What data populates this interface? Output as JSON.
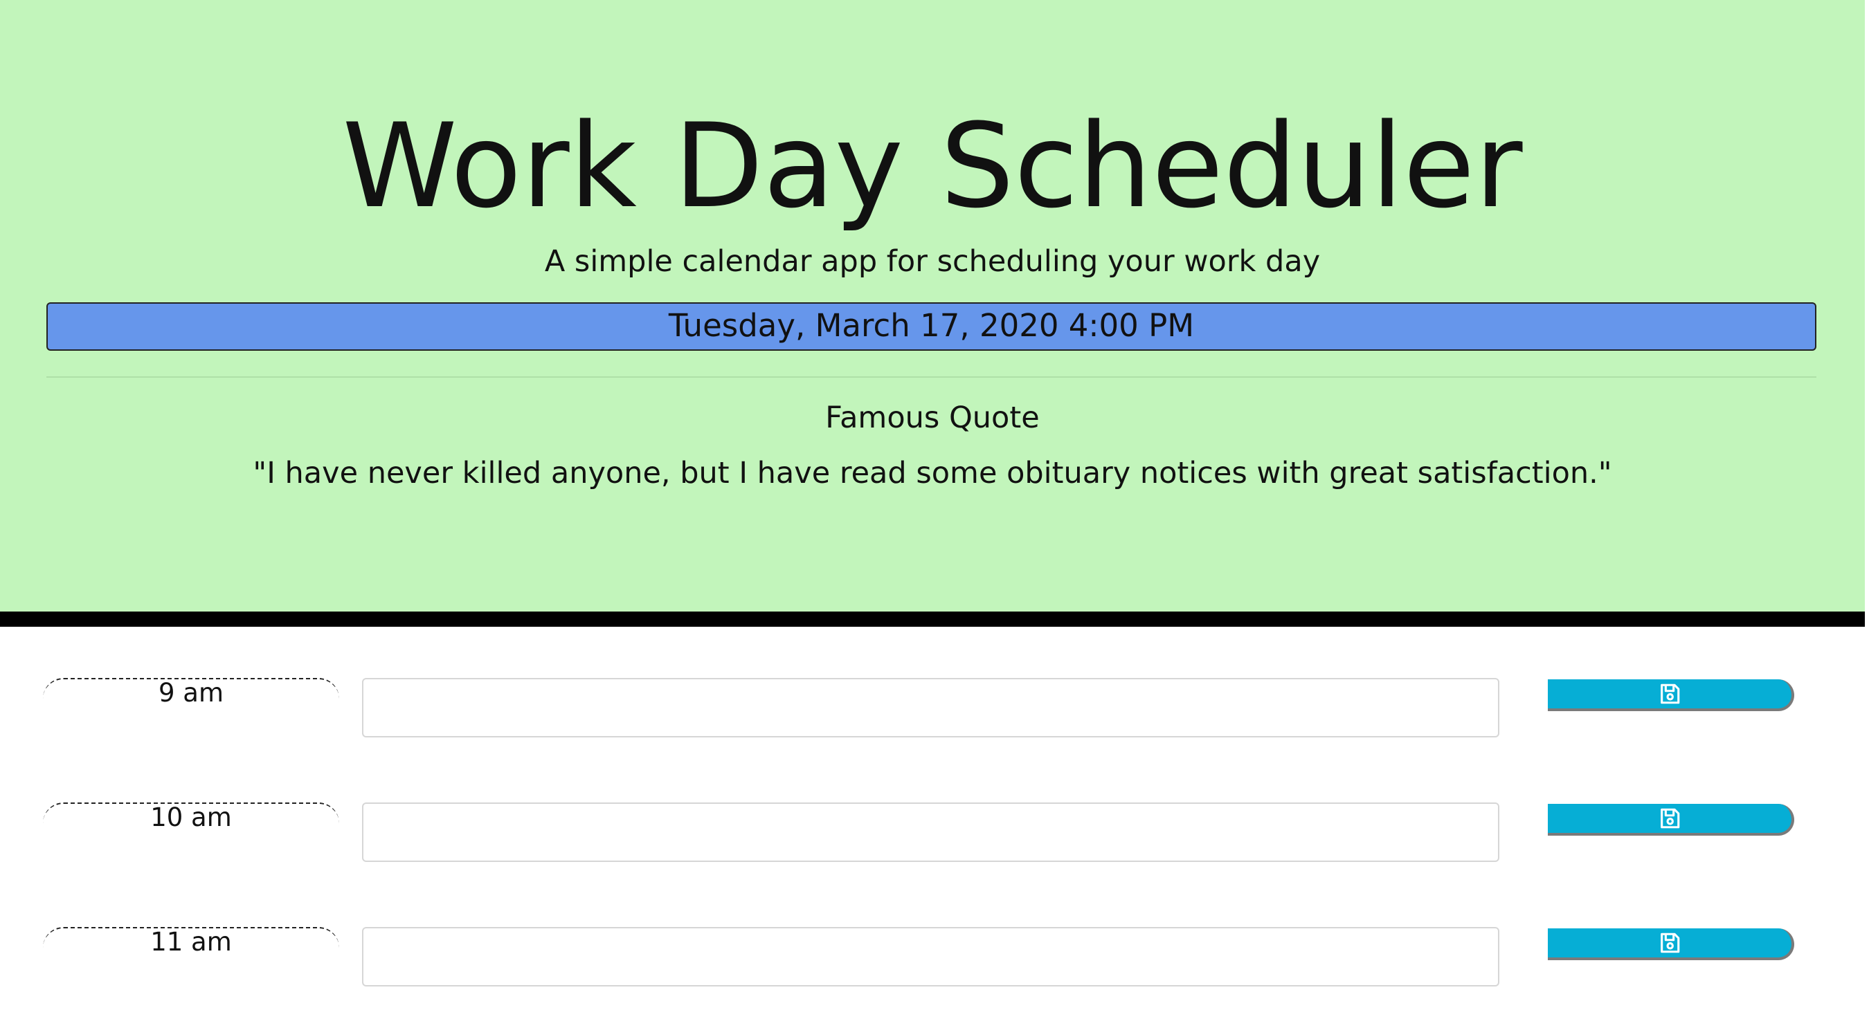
{
  "header": {
    "title": "Work Day Scheduler",
    "subtitle": "A simple calendar app for scheduling your work day",
    "current_day": "Tuesday, March 17, 2020 4:00 PM",
    "quote_heading": "Famous Quote",
    "quote_text": "\"I have never killed anyone, but I have read some obituary notices with great satisfaction.\""
  },
  "colors": {
    "header_background": "#c2f5bb",
    "current_day_background": "#6696eb",
    "save_button": "#06aed5",
    "separator": "#000000"
  },
  "rows": [
    {
      "hour": "9 am",
      "value": "",
      "save_icon": "floppy-disk-icon"
    },
    {
      "hour": "10 am",
      "value": "",
      "save_icon": "floppy-disk-icon"
    },
    {
      "hour": "11 am",
      "value": "",
      "save_icon": "floppy-disk-icon"
    }
  ]
}
